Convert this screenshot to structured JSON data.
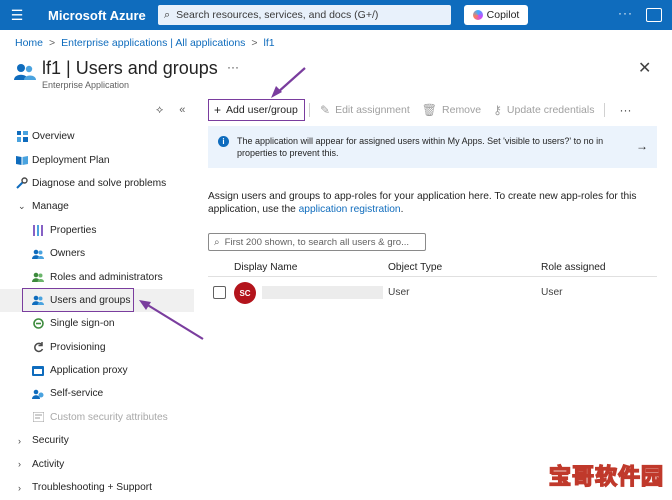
{
  "topbar": {
    "brand": "Microsoft Azure",
    "search_placeholder": "Search resources, services, and docs (G+/)",
    "copilot_label": "Copilot",
    "more": "···"
  },
  "breadcrumb": [
    "Home",
    "Enterprise applications | All applications",
    "lf1"
  ],
  "page": {
    "title": "lf1 | Users and groups",
    "subtitle": "Enterprise Application",
    "more": "···"
  },
  "sidebar": {
    "items": [
      {
        "label": "Overview",
        "icon": "overview-icon",
        "level": 0
      },
      {
        "label": "Deployment Plan",
        "icon": "book-icon",
        "level": 0
      },
      {
        "label": "Diagnose and solve problems",
        "icon": "wrench-icon",
        "level": 0
      },
      {
        "label": "Manage",
        "icon": "chevron-down-icon",
        "level": 0
      },
      {
        "label": "Properties",
        "icon": "properties-icon",
        "level": 1
      },
      {
        "label": "Owners",
        "icon": "owners-icon",
        "level": 1
      },
      {
        "label": "Roles and administrators",
        "icon": "roles-icon",
        "level": 1
      },
      {
        "label": "Users and groups",
        "icon": "users-icon",
        "level": 1,
        "active": true
      },
      {
        "label": "Single sign-on",
        "icon": "sso-icon",
        "level": 1
      },
      {
        "label": "Provisioning",
        "icon": "provisioning-icon",
        "level": 1
      },
      {
        "label": "Application proxy",
        "icon": "app-proxy-icon",
        "level": 1
      },
      {
        "label": "Self-service",
        "icon": "self-service-icon",
        "level": 1
      },
      {
        "label": "Custom security attributes",
        "icon": "custom-attributes-icon",
        "level": 1,
        "disabled": true
      },
      {
        "label": "Security",
        "icon": "chevron-right-icon",
        "level": 0
      },
      {
        "label": "Activity",
        "icon": "chevron-right-icon",
        "level": 0
      },
      {
        "label": "Troubleshooting + Support",
        "icon": "chevron-right-icon",
        "level": 0
      }
    ]
  },
  "toolbar": {
    "add_label": "Add user/group",
    "edit_label": "Edit assignment",
    "remove_label": "Remove",
    "update_label": "Update credentials",
    "more": "···"
  },
  "info": {
    "text": "The application will appear for assigned users within My Apps. Set 'visible to users?' to no in properties to prevent this."
  },
  "description": {
    "text": "Assign users and groups to app-roles for your application here. To create new app-roles for this application, use the",
    "link": "application registration",
    "end": "."
  },
  "filter": {
    "placeholder": "First 200 shown, to search all users & gro..."
  },
  "table": {
    "headers": [
      "Display Name",
      "Object Type",
      "Role assigned"
    ],
    "rows": [
      {
        "initials": "SC",
        "object_type": "User",
        "role": "User"
      }
    ]
  },
  "colors": {
    "topbar": "#0f6cbd",
    "link": "#0f6cbd",
    "annotation": "#7a3d9e",
    "avatar": "#b3141c"
  },
  "watermark": "宝哥软件园"
}
